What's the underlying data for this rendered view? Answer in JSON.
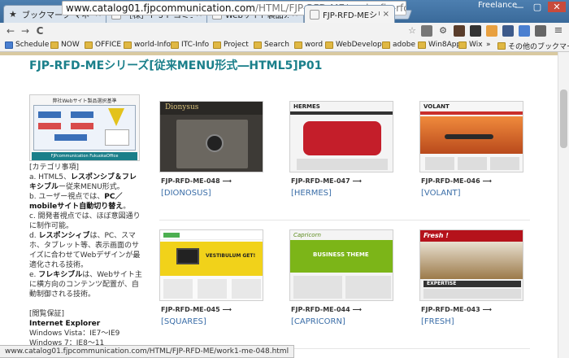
{
  "window": {
    "profile": "Freelance",
    "controls": [
      "—",
      "▢",
      "✕"
    ]
  },
  "tabs": [
    {
      "title": "ブックマーク マネージャ",
      "close": "×"
    },
    {
      "title": "［株］ＦＪＰコミュニケーション",
      "close": "×"
    },
    {
      "title": "Webサイト製品カタログ［20",
      "close": "×"
    },
    {
      "title": "FJP-RFD-MEシリーズ［従来",
      "close": "×"
    }
  ],
  "toolbar": {
    "back": "←",
    "forward": "→",
    "reload": "C",
    "url_host": "www.catalog01.fjpcommunication.com",
    "url_path": "/HTML/FJP-RFD-ME/works-fjp-rfd-me-01.",
    "star": "☆",
    "menu": "≡"
  },
  "bookmarks": [
    {
      "label": "Schedule"
    },
    {
      "label": "NOW"
    },
    {
      "label": "OFFICE"
    },
    {
      "label": "world-Info"
    },
    {
      "label": "ITC-Info"
    },
    {
      "label": "Project"
    },
    {
      "label": "Search"
    },
    {
      "label": "word"
    },
    {
      "label": "WebDeveloper"
    },
    {
      "label": "adobe"
    },
    {
      "label": "Win8App"
    },
    {
      "label": "Wix"
    },
    {
      "label": "»"
    },
    {
      "label": "その他のブックマーク"
    }
  ],
  "page": {
    "title": "FJP-RFD-MEシリーズ[従来MENU形式―HTML5]P01",
    "sidebar_image_caption": "弊社Webサイト製品選択基準",
    "sidebar_image_footer": "FJPcommunication FukuokaOffice",
    "sidebar": {
      "category_head": "[カテゴリ事項]",
      "a_pre": "a. HTML5、",
      "a_bold": "レスポンシブ＆フレキシブル",
      "a_post": "ー従来MENU形式。",
      "b_pre": "b. ユーザー視点では、",
      "b_bold": "PC／mobileサイト自動切り替え",
      "b_post": "。",
      "c_text": "c. 開発者視点では、ほぼ意図通りに制作可能。",
      "d_pre": "d. ",
      "d_bold": "レスポンシィブ",
      "d_post": "は、PC、スマホ、タブレット等、表示画面のサイズに合わせてWebデザインが最適化される技術。",
      "e_pre": "e. ",
      "e_bold": "フレキシブル",
      "e_post": "は、Webサイト主に横方向のコンテンツ配置が、自動制御される技術。",
      "browse_head": "[閲覧保証]",
      "browser": "Internet Explorer",
      "vista": "Windows Vista：IE7〜IE9",
      "win7": "Windows 7：IE8〜11"
    },
    "cards": [
      {
        "code": "FJP-RFD-ME-048 ⟶",
        "name": "[DIONOSUS]",
        "thumb_text": "Dionysus"
      },
      {
        "code": "FJP-RFD-ME-047 ⟶",
        "name": "[HERMES]",
        "thumb_text": "HERMES"
      },
      {
        "code": "FJP-RFD-ME-046 ⟶",
        "name": "[VOLANT]",
        "thumb_text": "VOLANT"
      },
      {
        "code": "FJP-RFD-ME-045 ⟶",
        "name": "[SQUARES]",
        "thumb_text": "VESTIBULUM GET!"
      },
      {
        "code": "FJP-RFD-ME-044 ⟶",
        "name": "[CAPRICORN]",
        "thumb_text": "BUSINESS THEME"
      },
      {
        "code": "FJP-RFD-ME-043 ⟶",
        "name": "[FRESH]",
        "thumb_text": "EXPERTISE"
      }
    ]
  },
  "status": "www.catalog01.fjpcommunication.com/HTML/FJP-RFD-ME/work1-me-048.html"
}
